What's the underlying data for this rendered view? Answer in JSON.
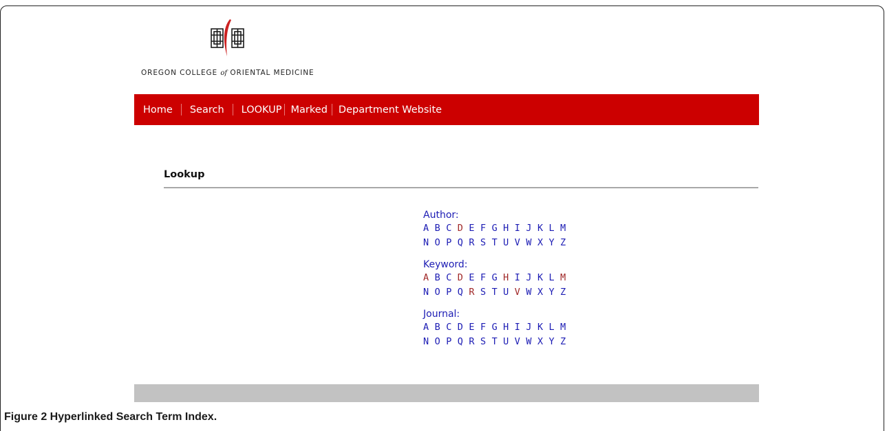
{
  "logo": {
    "text_before": "OREGON COLLEGE",
    "text_of": "of",
    "text_after": "ORIENTAL MEDICINE",
    "mark_icon": "lattice-window-logo-icon",
    "mark_accent_color": "#cc2222"
  },
  "nav": {
    "background": "#cc0000",
    "items": [
      {
        "label": "Home"
      },
      {
        "label": "Search"
      },
      {
        "label": "LOOKUP"
      },
      {
        "label": "Marked"
      },
      {
        "label": "Department Website"
      }
    ]
  },
  "lookup": {
    "heading": "Lookup"
  },
  "index": {
    "link_color": "#1c1cb4",
    "visited_color": "#a02828",
    "groups": [
      {
        "label": "Author:",
        "rows": [
          [
            "A",
            "B",
            "C",
            "D",
            "E",
            "F",
            "G",
            "H",
            "I",
            "J",
            "K",
            "L",
            "M"
          ],
          [
            "N",
            "O",
            "P",
            "Q",
            "R",
            "S",
            "T",
            "U",
            "V",
            "W",
            "X",
            "Y",
            "Z"
          ]
        ],
        "visited": [
          "D"
        ]
      },
      {
        "label": "Keyword:",
        "rows": [
          [
            "A",
            "B",
            "C",
            "D",
            "E",
            "F",
            "G",
            "H",
            "I",
            "J",
            "K",
            "L",
            "M"
          ],
          [
            "N",
            "O",
            "P",
            "Q",
            "R",
            "S",
            "T",
            "U",
            "V",
            "W",
            "X",
            "Y",
            "Z"
          ]
        ],
        "visited": [
          "A",
          "D",
          "H",
          "M",
          "R",
          "V"
        ]
      },
      {
        "label": "Journal:",
        "rows": [
          [
            "A",
            "B",
            "C",
            "D",
            "E",
            "F",
            "G",
            "H",
            "I",
            "J",
            "K",
            "L",
            "M"
          ],
          [
            "N",
            "O",
            "P",
            "Q",
            "R",
            "S",
            "T",
            "U",
            "V",
            "W",
            "X",
            "Y",
            "Z"
          ]
        ],
        "visited": []
      }
    ]
  },
  "caption": {
    "text": "Figure 2 Hyperlinked Search Term Index."
  }
}
